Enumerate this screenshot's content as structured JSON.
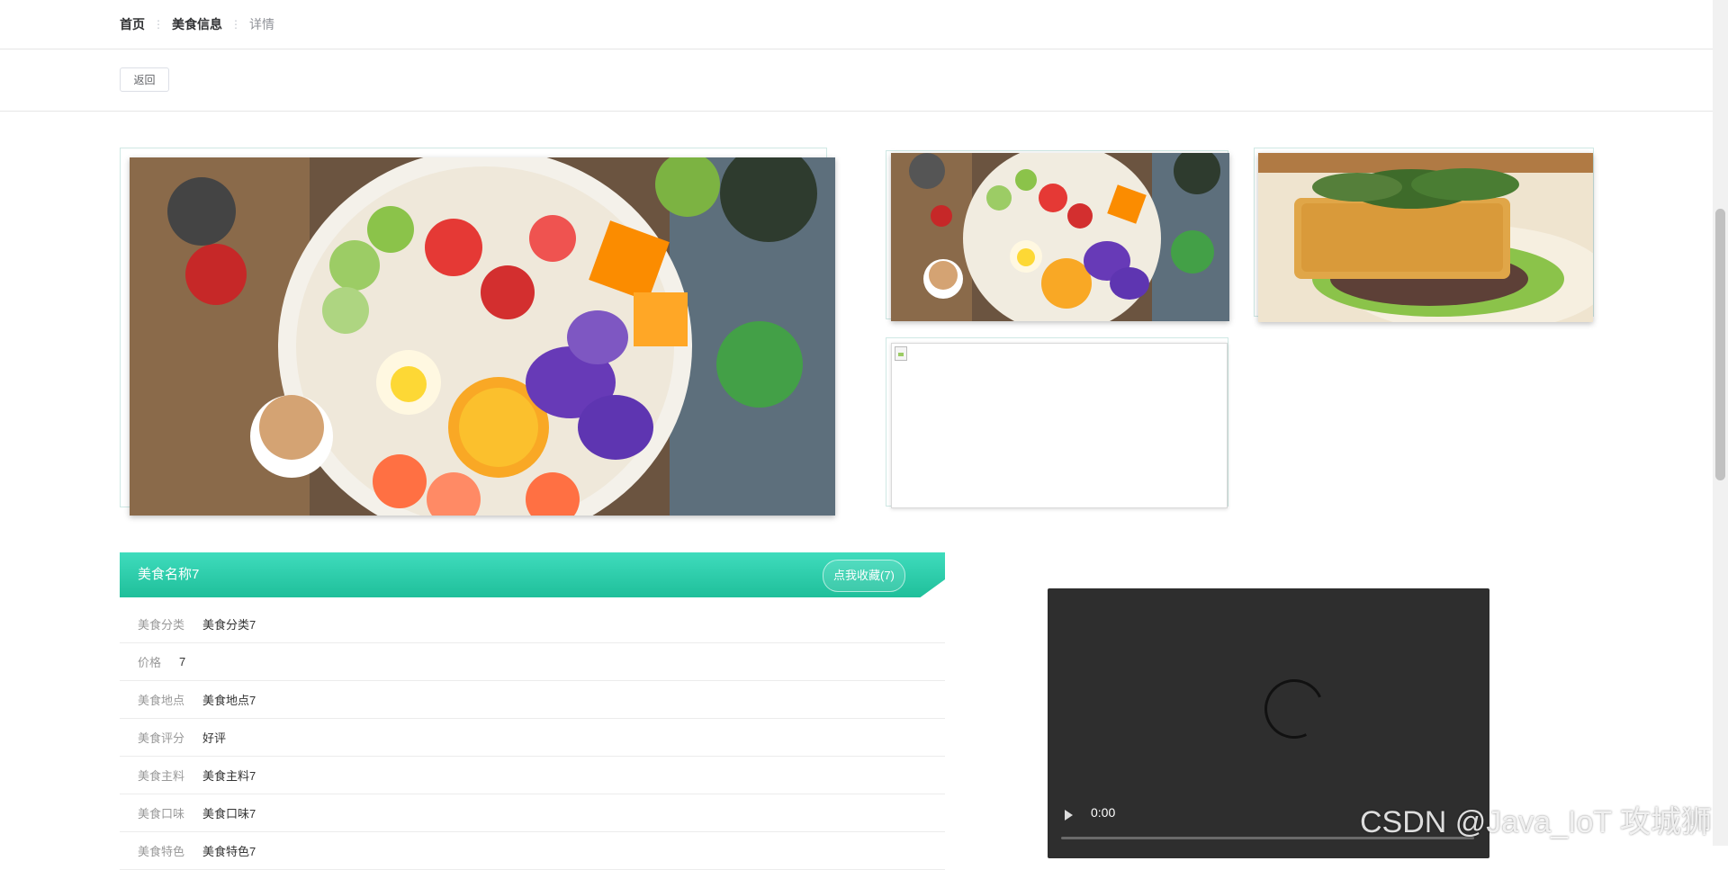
{
  "breadcrumb": {
    "home": "首页",
    "section": "美食信息",
    "current": "详情",
    "separator": "⋮"
  },
  "back_button": "返回",
  "detail": {
    "title": "美食名称7",
    "favorite_label": "点我收藏(7)",
    "rows": [
      {
        "label": "美食分类",
        "value": "美食分类7"
      },
      {
        "label": "价格",
        "value": "7"
      },
      {
        "label": "美食地点",
        "value": "美食地点7"
      },
      {
        "label": "美食评分",
        "value": "好评"
      },
      {
        "label": "美食主料",
        "value": "美食主料7"
      },
      {
        "label": "美食口味",
        "value": "美食口味7"
      },
      {
        "label": "美食特色",
        "value": "美食特色7"
      }
    ]
  },
  "video": {
    "time": "0:00"
  },
  "watermark": "CSDN @Java_IoT 攻城狮",
  "colors": {
    "accent_start": "#3fdcbd",
    "accent_end": "#1fbf9a"
  }
}
